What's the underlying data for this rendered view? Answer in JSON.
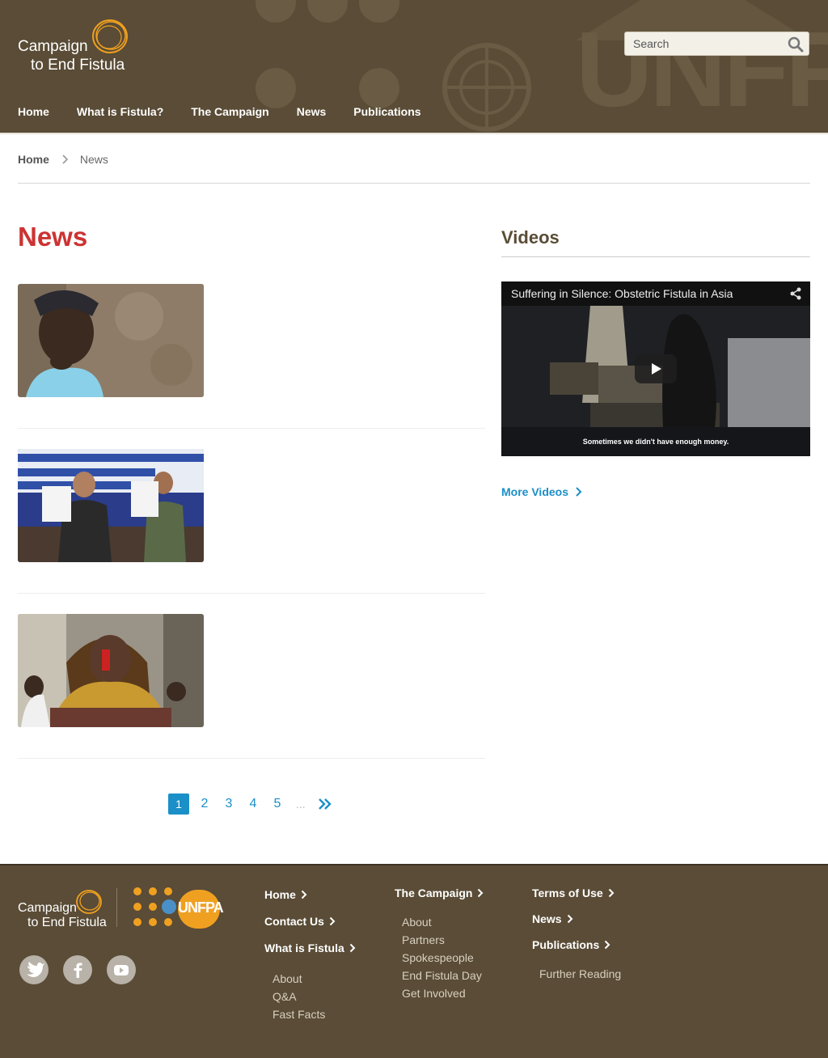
{
  "header": {
    "logo_line1": "Campaign",
    "logo_line2": "to End Fistula",
    "search_placeholder": "Search",
    "watermark": "UNFPA",
    "nav": [
      "Home",
      "What is Fistula?",
      "The Campaign",
      "News",
      "Publications"
    ]
  },
  "breadcrumb": {
    "home": "Home",
    "current": "News"
  },
  "main": {
    "title": "News",
    "pagination": {
      "pages": [
        "1",
        "2",
        "3",
        "4",
        "5"
      ],
      "ellipsis": "...",
      "active": "1"
    }
  },
  "sidebar": {
    "title": "Videos",
    "video": {
      "title": "Suffering in Silence: Obstetric Fistula in Asia",
      "caption": "Sometimes we didn't have enough money."
    },
    "more_videos": "More Videos"
  },
  "footer": {
    "logo_line1": "Campaign",
    "logo_line2": "to End Fistula",
    "unfpa": "UNFPA",
    "col1": {
      "links": [
        "Home",
        "Contact Us",
        "What is Fistula"
      ],
      "sub": [
        "About",
        "Q&A",
        "Fast Facts"
      ]
    },
    "col2": {
      "head": "The Campaign",
      "sub": [
        "About",
        "Partners",
        "Spokespeople",
        "End Fistula Day",
        "Get Involved"
      ]
    },
    "col3": {
      "links": [
        "Terms of Use",
        "News",
        "Publications"
      ],
      "sub": [
        "Further Reading"
      ]
    }
  },
  "colors": {
    "brand_brown": "#5a4c36",
    "title_red": "#cc3333",
    "link_blue": "#1a8fc8",
    "logo_orange": "#f0a020"
  }
}
